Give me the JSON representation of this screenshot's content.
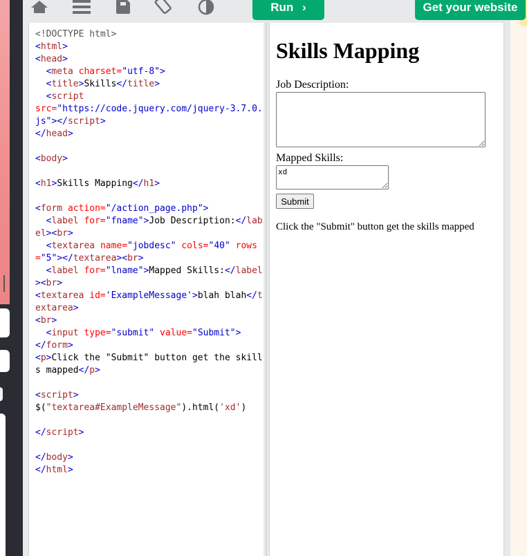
{
  "toolbar": {
    "icons": [
      "home-icon",
      "menu-icon",
      "save-icon",
      "rotate-icon",
      "contrast-icon"
    ],
    "run_label": "Run",
    "run_chevron": "›",
    "get_website_label": "Get your website"
  },
  "colors": {
    "accent": "#04aa6d",
    "tag": "#0000cd",
    "tag_name": "#a52a2a",
    "attr": "#ff0000"
  },
  "editor": {
    "lines": [
      [
        [
          "doc",
          "<!DOCTYPE html>"
        ]
      ],
      [
        [
          "tag",
          "<"
        ],
        [
          "name",
          "html"
        ],
        [
          "tag",
          ">"
        ]
      ],
      [
        [
          "tag",
          "<"
        ],
        [
          "name",
          "head"
        ],
        [
          "tag",
          ">"
        ]
      ],
      [
        [
          "txt",
          "  "
        ],
        [
          "tag",
          "<"
        ],
        [
          "name",
          "meta "
        ],
        [
          "attr",
          "charset="
        ],
        [
          "val",
          "\"utf-8\""
        ],
        [
          "tag",
          ">"
        ]
      ],
      [
        [
          "txt",
          "  "
        ],
        [
          "tag",
          "<"
        ],
        [
          "name",
          "title"
        ],
        [
          "tag",
          ">"
        ],
        [
          "txt",
          "Skills"
        ],
        [
          "tag",
          "</"
        ],
        [
          "name",
          "title"
        ],
        [
          "tag",
          ">"
        ]
      ],
      [
        [
          "txt",
          "  "
        ],
        [
          "tag",
          "<"
        ],
        [
          "name",
          "script"
        ]
      ],
      [
        [
          "attr",
          "src="
        ],
        [
          "val",
          "\"https://code.jquery.com/jquery-3.7.0.js\""
        ],
        [
          "tag",
          ">"
        ],
        [
          "tag",
          "</"
        ],
        [
          "name",
          "script"
        ],
        [
          "tag",
          ">"
        ]
      ],
      [
        [
          "tag",
          "</"
        ],
        [
          "name",
          "head"
        ],
        [
          "tag",
          ">"
        ]
      ],
      [
        [
          "txt",
          ""
        ]
      ],
      [
        [
          "tag",
          "<"
        ],
        [
          "name",
          "body"
        ],
        [
          "tag",
          ">"
        ]
      ],
      [
        [
          "txt",
          ""
        ]
      ],
      [
        [
          "tag",
          "<"
        ],
        [
          "name",
          "h1"
        ],
        [
          "tag",
          ">"
        ],
        [
          "txt",
          "Skills Mapping"
        ],
        [
          "tag",
          "</"
        ],
        [
          "name",
          "h1"
        ],
        [
          "tag",
          ">"
        ]
      ],
      [
        [
          "txt",
          ""
        ]
      ],
      [
        [
          "tag",
          "<"
        ],
        [
          "name",
          "form "
        ],
        [
          "attr",
          "action="
        ],
        [
          "val",
          "\"/action_page.php\""
        ],
        [
          "tag",
          ">"
        ]
      ],
      [
        [
          "txt",
          "  "
        ],
        [
          "tag",
          "<"
        ],
        [
          "name",
          "label "
        ],
        [
          "attr",
          "for="
        ],
        [
          "val",
          "\"fname\""
        ],
        [
          "tag",
          ">"
        ],
        [
          "txt",
          "Job Description:"
        ],
        [
          "tag",
          "</"
        ],
        [
          "name",
          "label"
        ],
        [
          "tag",
          ">"
        ],
        [
          "tag",
          "<"
        ],
        [
          "name",
          "br"
        ],
        [
          "tag",
          ">"
        ]
      ],
      [
        [
          "txt",
          "  "
        ],
        [
          "tag",
          "<"
        ],
        [
          "name",
          "textarea "
        ],
        [
          "attr",
          "name="
        ],
        [
          "val",
          "\"jobdesc\" "
        ],
        [
          "attr",
          "cols="
        ],
        [
          "val",
          "\"40\" "
        ],
        [
          "attr",
          "rows="
        ],
        [
          "val",
          "\"5\""
        ],
        [
          "tag",
          ">"
        ],
        [
          "tag",
          "</"
        ],
        [
          "name",
          "textarea"
        ],
        [
          "tag",
          ">"
        ],
        [
          "tag",
          "<"
        ],
        [
          "name",
          "br"
        ],
        [
          "tag",
          ">"
        ]
      ],
      [
        [
          "txt",
          "  "
        ],
        [
          "tag",
          "<"
        ],
        [
          "name",
          "label "
        ],
        [
          "attr",
          "for="
        ],
        [
          "val",
          "\"lname\""
        ],
        [
          "tag",
          ">"
        ],
        [
          "txt",
          "Mapped Skills:"
        ],
        [
          "tag",
          "</"
        ],
        [
          "name",
          "label"
        ],
        [
          "tag",
          ">"
        ],
        [
          "tag",
          "<"
        ],
        [
          "name",
          "br"
        ],
        [
          "tag",
          ">"
        ]
      ],
      [
        [
          "tag",
          "<"
        ],
        [
          "name",
          "textarea "
        ],
        [
          "attr",
          "id="
        ],
        [
          "val",
          "'ExampleMessage'"
        ],
        [
          "tag",
          ">"
        ],
        [
          "txt",
          "blah blah"
        ],
        [
          "tag",
          "</"
        ],
        [
          "name",
          "textarea"
        ],
        [
          "tag",
          ">"
        ]
      ],
      [
        [
          "tag",
          "<"
        ],
        [
          "name",
          "br"
        ],
        [
          "tag",
          ">"
        ]
      ],
      [
        [
          "txt",
          "  "
        ],
        [
          "tag",
          "<"
        ],
        [
          "name",
          "input "
        ],
        [
          "attr",
          "type="
        ],
        [
          "val",
          "\"submit\" "
        ],
        [
          "attr",
          "value="
        ],
        [
          "val",
          "\"Submit\""
        ],
        [
          "tag",
          ">"
        ]
      ],
      [
        [
          "tag",
          "</"
        ],
        [
          "name",
          "form"
        ],
        [
          "tag",
          ">"
        ]
      ],
      [
        [
          "tag",
          "<"
        ],
        [
          "name",
          "p"
        ],
        [
          "tag",
          ">"
        ],
        [
          "txt",
          "Click the \"Submit\" button get the skills mapped"
        ],
        [
          "tag",
          "</"
        ],
        [
          "name",
          "p"
        ],
        [
          "tag",
          ">"
        ]
      ],
      [
        [
          "txt",
          ""
        ]
      ],
      [
        [
          "tag",
          "<"
        ],
        [
          "name",
          "script"
        ],
        [
          "tag",
          ">"
        ]
      ],
      [
        [
          "txt",
          "$("
        ],
        [
          "str",
          "\"textarea#ExampleMessage\""
        ],
        [
          "txt",
          ").html("
        ],
        [
          "str",
          "'xd'"
        ],
        [
          "txt",
          ")"
        ]
      ],
      [
        [
          "txt",
          ""
        ]
      ],
      [
        [
          "tag",
          "</"
        ],
        [
          "name",
          "script"
        ],
        [
          "tag",
          ">"
        ]
      ],
      [
        [
          "txt",
          ""
        ]
      ],
      [
        [
          "tag",
          "</"
        ],
        [
          "name",
          "body"
        ],
        [
          "tag",
          ">"
        ]
      ],
      [
        [
          "tag",
          "</"
        ],
        [
          "name",
          "html"
        ],
        [
          "tag",
          ">"
        ]
      ]
    ]
  },
  "result": {
    "heading": "Skills Mapping",
    "job_label": "Job Description:",
    "job_value": "",
    "mapped_label": "Mapped Skills:",
    "mapped_value": "xd",
    "submit_label": "Submit",
    "paragraph": "Click the \"Submit\" button get the skills mapped"
  }
}
